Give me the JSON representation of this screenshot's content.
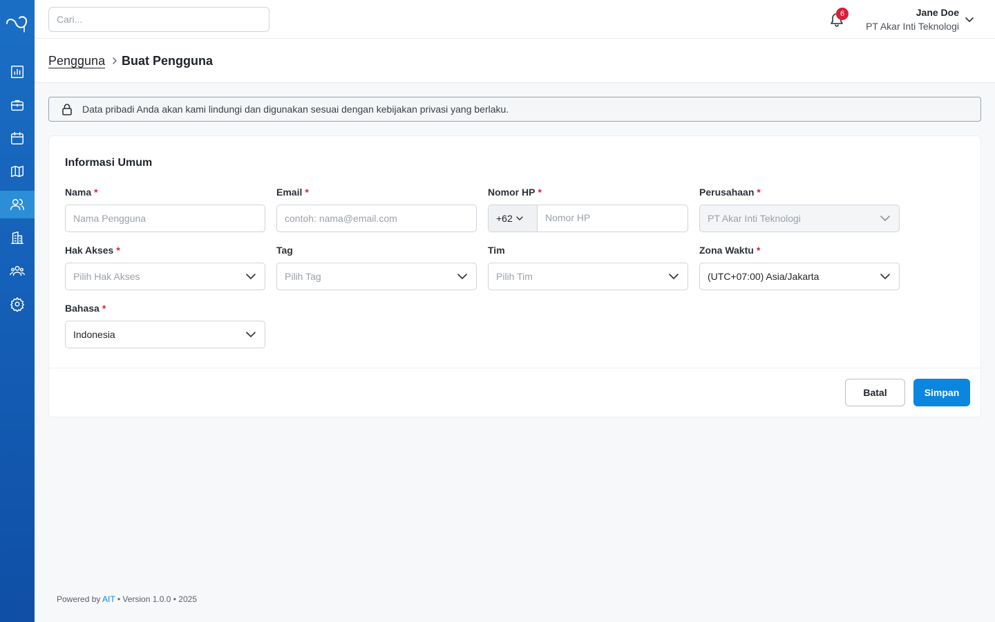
{
  "sidebar": {
    "logo": "brand-logo",
    "items": [
      {
        "icon": "chart-icon",
        "active": false
      },
      {
        "icon": "briefcase-icon",
        "active": false
      },
      {
        "icon": "calendar-icon",
        "active": false
      },
      {
        "icon": "map-icon",
        "active": false
      },
      {
        "icon": "users-icon",
        "active": true
      },
      {
        "icon": "building-icon",
        "active": false
      },
      {
        "icon": "team-icon",
        "active": false
      },
      {
        "icon": "settings-icon",
        "active": false
      }
    ]
  },
  "topbar": {
    "search_placeholder": "Cari...",
    "notification_count": "6",
    "user_name": "Jane Doe",
    "user_company": "PT Akar Inti Teknologi"
  },
  "breadcrumb": {
    "parent": "Pengguna",
    "current": "Buat Pengguna"
  },
  "notice": {
    "text": "Data pribadi Anda akan kami lindungi dan digunakan sesuai dengan kebijakan privasi yang berlaku."
  },
  "form": {
    "title": "Informasi Umum",
    "required_mark": "*",
    "fields": {
      "name": {
        "label": "Nama",
        "placeholder": "Nama Pengguna"
      },
      "email": {
        "label": "Email",
        "placeholder": "contoh: nama@email.com"
      },
      "phone": {
        "label": "Nomor HP",
        "prefix": "+62",
        "placeholder": "Nomor HP"
      },
      "company": {
        "label": "Perusahaan",
        "value": "PT Akar Inti Teknologi"
      },
      "access": {
        "label": "Hak Akses",
        "placeholder": "Pilih Hak Akses"
      },
      "tag": {
        "label": "Tag",
        "placeholder": "Pilih Tag"
      },
      "team": {
        "label": "Tim",
        "placeholder": "Pilih Tim"
      },
      "timezone": {
        "label": "Zona Waktu",
        "value": "(UTC+07:00) Asia/Jakarta"
      },
      "language": {
        "label": "Bahasa",
        "value": "Indonesia"
      }
    },
    "cancel_label": "Batal",
    "save_label": "Simpan"
  },
  "footer": {
    "prefix": "Powered by",
    "brand": "AIT",
    "suffix": "• Version 1.0.0 • 2025"
  },
  "colors": {
    "sidebar": "#1560b8",
    "accent": "#0a86df",
    "required": "#d81e3a",
    "badge": "#d81e3a"
  }
}
